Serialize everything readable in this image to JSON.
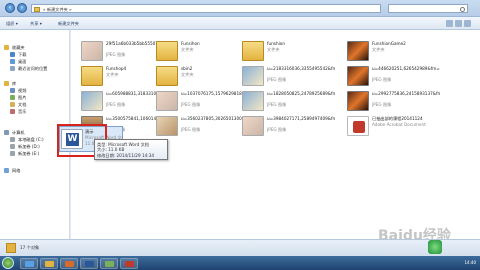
{
  "address": {
    "crumb": "» 新建文件夹 »"
  },
  "toolbar": {
    "organize": "组织 ▾",
    "share": "共享 ▾",
    "new_folder": "新建文件夹"
  },
  "sidebar": {
    "items": [
      {
        "label": "收藏夹",
        "level": 0,
        "color": "#e3b341"
      },
      {
        "label": "下载",
        "level": 1,
        "color": "#4a86c8"
      },
      {
        "label": "桌面",
        "level": 1,
        "color": "#5b9bd5"
      },
      {
        "label": "最近访问的位置",
        "level": 1,
        "color": "#8aa6c4"
      },
      {
        "label": "库",
        "level": 0,
        "color": "#e3b341"
      },
      {
        "label": "视频",
        "level": 1,
        "color": "#6c8ebf"
      },
      {
        "label": "图片",
        "level": 1,
        "color": "#7ab05a"
      },
      {
        "label": "文档",
        "level": 1,
        "color": "#d6b05a"
      },
      {
        "label": "音乐",
        "level": 1,
        "color": "#c06c6c"
      },
      {
        "label": "计算机",
        "level": 0,
        "color": "#7f98b6"
      },
      {
        "label": "本地磁盘 (C:)",
        "level": 1,
        "color": "#9aa4ad"
      },
      {
        "label": "新加卷 (D:)",
        "level": 1,
        "color": "#9aa4ad"
      },
      {
        "label": "新加卷 (E:)",
        "level": 1,
        "color": "#9aa4ad"
      },
      {
        "label": "网络",
        "level": 0,
        "color": "#6fa0d8"
      }
    ]
  },
  "files": [
    {
      "name": "29f51a6b033b5bb555078ca235d163396700bc58",
      "type": "JPEG 图像",
      "size": "",
      "kind": "img-a"
    },
    {
      "name": "Funsihon",
      "type": "文件夹",
      "size": "",
      "kind": "folder"
    },
    {
      "name": "funshion",
      "type": "文件夹",
      "size": "",
      "kind": "folder"
    },
    {
      "name": "FunshionGame2",
      "type": "文件夹",
      "size": "",
      "kind": "img-b"
    },
    {
      "name": "Funshop4",
      "type": "文件夹",
      "size": "",
      "kind": "folder"
    },
    {
      "name": "sbin2",
      "type": "文件夹",
      "size": "",
      "kind": "folder"
    },
    {
      "name": "u=2183316036,3355495542&fm=23&gp=0[1]",
      "type": "JPEG 图像",
      "size": "",
      "kind": "img-c"
    },
    {
      "name": "u=446620251,626542989&fm=23&gp=0[1]",
      "type": "JPEG 图像",
      "size": "",
      "kind": "img-b"
    },
    {
      "name": "u=605988831,3183310789&fm=23&gp=0[1]",
      "type": "JPEG 图像",
      "size": "",
      "kind": "img-c"
    },
    {
      "name": "u=1037076175,1579629818&fm=23&gp=0[1]",
      "type": "JPEG 图像",
      "size": "",
      "kind": "img-a"
    },
    {
      "name": "u=1828050825,2478925689&fm=23&gp=0[1]",
      "type": "JPEG 图像",
      "size": "",
      "kind": "img-c"
    },
    {
      "name": "u=2992775836,2415893137&fm=23&gp=0[1]",
      "type": "JPEG 图像",
      "size": "",
      "kind": "img-b"
    },
    {
      "name": "u=3500575841,1060147332&fm=23&gp=0[1]",
      "type": "JPEG 图像",
      "size": "",
      "kind": "img-d"
    },
    {
      "name": "u=3560237805,3026501300&fm=23&gp=0[1]",
      "type": "JPEG 图像",
      "size": "",
      "kind": "img-e"
    },
    {
      "name": "u=3984027171,2589497409&fm=23&gp=0[1]",
      "type": "JPEG 图像",
      "size": "",
      "kind": "img-a"
    },
    {
      "name": "已抽出部的课程20141124",
      "type": "Adobe Acrobat Document",
      "size": "",
      "kind": "pdf"
    },
    {
      "name": "演示",
      "type": "Microsoft Word 文档",
      "size": "11.0 KB",
      "kind": "word"
    }
  ],
  "tooltip": {
    "line1": "类型: Microsoft Word 文档",
    "line2": "大小: 11.0 KB",
    "line3": "修改日期: 2014/11/29 14:34"
  },
  "status": {
    "count": "17 个对象"
  },
  "tray": {
    "time": "14:40"
  },
  "watermark": "Baidu经验"
}
